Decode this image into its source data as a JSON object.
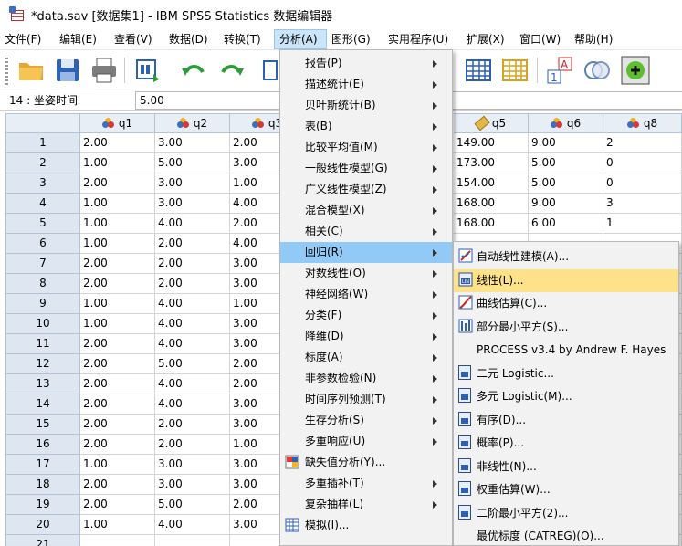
{
  "window": {
    "title": "*data.sav [数据集1] - IBM SPSS Statistics 数据编辑器"
  },
  "menubar": [
    {
      "label": "文件(F)"
    },
    {
      "label": "编辑(E)"
    },
    {
      "label": "查看(V)"
    },
    {
      "label": "数据(D)"
    },
    {
      "label": "转换(T)"
    },
    {
      "label": "分析(A)"
    },
    {
      "label": "图形(G)"
    },
    {
      "label": "实用程序(U)"
    },
    {
      "label": "扩展(X)"
    },
    {
      "label": "窗口(W)"
    },
    {
      "label": "帮助(H)"
    }
  ],
  "cellbar": {
    "reference": "14 : 坐姿时间",
    "value": "5.00"
  },
  "columns": [
    "q1",
    "q2",
    "q3",
    "q5",
    "q6",
    "q8"
  ],
  "rows": [
    {
      "n": "1",
      "q1": "2.00",
      "q2": "3.00",
      "q3": "2.00",
      "q5": "149.00",
      "q6": "9.00",
      "q8": "2"
    },
    {
      "n": "2",
      "q1": "1.00",
      "q2": "5.00",
      "q3": "3.00",
      "q5": "173.00",
      "q6": "5.00",
      "q8": "0"
    },
    {
      "n": "3",
      "q1": "2.00",
      "q2": "3.00",
      "q3": "1.00",
      "q5": "154.00",
      "q6": "5.00",
      "q8": "0"
    },
    {
      "n": "4",
      "q1": "1.00",
      "q2": "3.00",
      "q3": "4.00",
      "q5": "168.00",
      "q6": "9.00",
      "q8": "3"
    },
    {
      "n": "5",
      "q1": "1.00",
      "q2": "4.00",
      "q3": "2.00",
      "q5": "168.00",
      "q6": "6.00",
      "q8": "1"
    },
    {
      "n": "6",
      "q1": "1.00",
      "q2": "2.00",
      "q3": "4.00",
      "q5": "",
      "q6": "",
      "q8": ""
    },
    {
      "n": "7",
      "q1": "2.00",
      "q2": "2.00",
      "q3": "3.00",
      "q5": "",
      "q6": "",
      "q8": ""
    },
    {
      "n": "8",
      "q1": "2.00",
      "q2": "2.00",
      "q3": "3.00",
      "q5": "",
      "q6": "",
      "q8": ""
    },
    {
      "n": "9",
      "q1": "1.00",
      "q2": "4.00",
      "q3": "1.00",
      "q5": "",
      "q6": "",
      "q8": ""
    },
    {
      "n": "10",
      "q1": "1.00",
      "q2": "4.00",
      "q3": "3.00",
      "q5": "",
      "q6": "",
      "q8": ""
    },
    {
      "n": "11",
      "q1": "2.00",
      "q2": "4.00",
      "q3": "3.00",
      "q5": "",
      "q6": "",
      "q8": ""
    },
    {
      "n": "12",
      "q1": "2.00",
      "q2": "5.00",
      "q3": "2.00",
      "q5": "",
      "q6": "",
      "q8": ""
    },
    {
      "n": "13",
      "q1": "2.00",
      "q2": "4.00",
      "q3": "2.00",
      "q5": "",
      "q6": "",
      "q8": ""
    },
    {
      "n": "14",
      "q1": "2.00",
      "q2": "4.00",
      "q3": "3.00",
      "q5": "",
      "q6": "",
      "q8": ""
    },
    {
      "n": "15",
      "q1": "2.00",
      "q2": "2.00",
      "q3": "3.00",
      "q5": "",
      "q6": "",
      "q8": ""
    },
    {
      "n": "16",
      "q1": "2.00",
      "q2": "2.00",
      "q3": "1.00",
      "q5": "",
      "q6": "",
      "q8": ""
    },
    {
      "n": "17",
      "q1": "1.00",
      "q2": "3.00",
      "q3": "3.00",
      "q5": "",
      "q6": "",
      "q8": ""
    },
    {
      "n": "18",
      "q1": "2.00",
      "q2": "3.00",
      "q3": "3.00",
      "q5": "",
      "q6": "",
      "q8": ""
    },
    {
      "n": "19",
      "q1": "2.00",
      "q2": "5.00",
      "q3": "2.00",
      "q5": "",
      "q6": "",
      "q8": ""
    },
    {
      "n": "20",
      "q1": "1.00",
      "q2": "4.00",
      "q3": "3.00",
      "q5": "",
      "q6": "",
      "q8": ""
    },
    {
      "n": "21",
      "q1": "",
      "q2": "",
      "q3": "",
      "q5": "",
      "q6": "",
      "q8": ""
    }
  ],
  "analyze_menu": [
    {
      "label": "报告(P)",
      "submenu": true
    },
    {
      "label": "描述统计(E)",
      "submenu": true
    },
    {
      "label": "贝叶斯统计(B)",
      "submenu": true
    },
    {
      "label": "表(B)",
      "submenu": true
    },
    {
      "label": "比较平均值(M)",
      "submenu": true
    },
    {
      "label": "一般线性模型(G)",
      "submenu": true
    },
    {
      "label": "广义线性模型(Z)",
      "submenu": true
    },
    {
      "label": "混合模型(X)",
      "submenu": true
    },
    {
      "label": "相关(C)",
      "submenu": true
    },
    {
      "label": "回归(R)",
      "submenu": true,
      "active": true
    },
    {
      "label": "对数线性(O)",
      "submenu": true
    },
    {
      "label": "神经网络(W)",
      "submenu": true
    },
    {
      "label": "分类(F)",
      "submenu": true
    },
    {
      "label": "降维(D)",
      "submenu": true
    },
    {
      "label": "标度(A)",
      "submenu": true
    },
    {
      "label": "非参数检验(N)",
      "submenu": true
    },
    {
      "label": "时间序列预测(T)",
      "submenu": true
    },
    {
      "label": "生存分析(S)",
      "submenu": true
    },
    {
      "label": "多重响应(U)",
      "submenu": true
    },
    {
      "label": "缺失值分析(Y)...",
      "submenu": false,
      "icon": "missing-values-icon"
    },
    {
      "label": "多重插补(T)",
      "submenu": true
    },
    {
      "label": "复杂抽样(L)",
      "submenu": true
    },
    {
      "label": "模拟(I)...",
      "submenu": false,
      "icon": "simulation-icon"
    }
  ],
  "regression_menu": [
    {
      "label": "自动线性建模(A)...",
      "icon": "auto-linear-icon"
    },
    {
      "label": "线性(L)...",
      "icon": "linear-icon",
      "highlight": true
    },
    {
      "label": "曲线估算(C)...",
      "icon": "curve-estimation-icon"
    },
    {
      "label": "部分最小平方(S)...",
      "icon": "partial-least-squares-icon"
    },
    {
      "label": "PROCESS v3.4 by Andrew F. Hayes",
      "icon": ""
    },
    {
      "label": "二元 Logistic...",
      "icon": "binary-logistic-icon"
    },
    {
      "label": "多元 Logistic(M)...",
      "icon": "multinomial-logistic-icon"
    },
    {
      "label": "有序(D)...",
      "icon": "ordinal-icon"
    },
    {
      "label": "概率(P)...",
      "icon": "probit-icon"
    },
    {
      "label": "非线性(N)...",
      "icon": "nonlinear-icon"
    },
    {
      "label": "权重估算(W)...",
      "icon": "weight-estimation-icon"
    },
    {
      "label": "二阶最小平方(2)...",
      "icon": "two-stage-least-squares-icon"
    },
    {
      "label": "最优标度 (CATREG)(O)...",
      "icon": ""
    }
  ],
  "colors": {
    "menu_active": "#cce4f7",
    "item_highlight": "#91c9f7",
    "sub_highlight": "#fde28a",
    "row_header": "#dde6f1"
  }
}
